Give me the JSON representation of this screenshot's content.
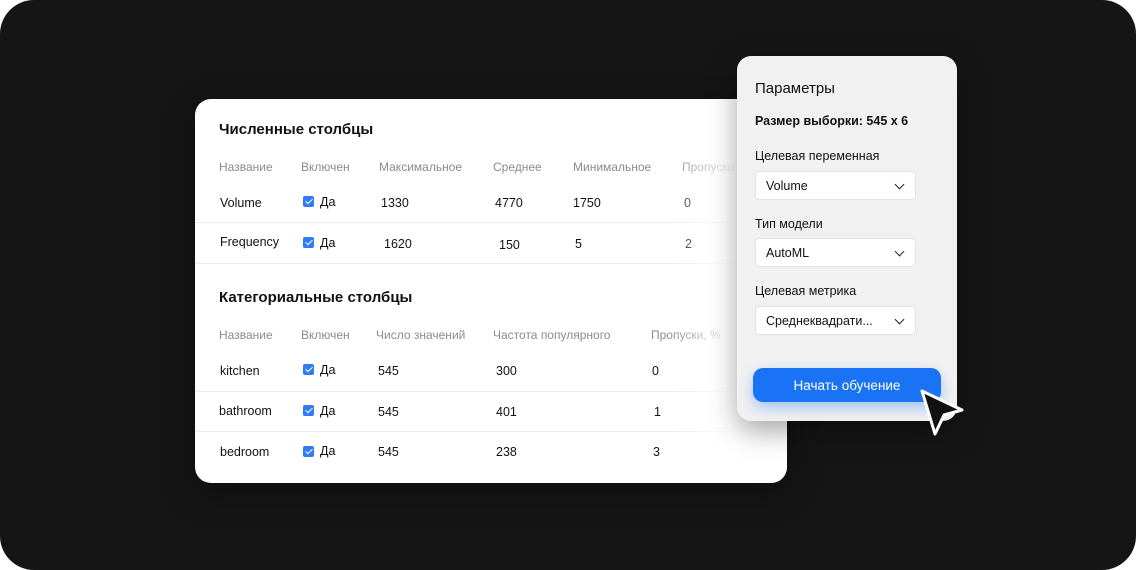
{
  "numeric": {
    "title": "Численные столбцы",
    "headers": [
      "Название",
      "Включен",
      "Максимальное",
      "Среднее",
      "Минимальное",
      "Пропуски"
    ],
    "rows": [
      {
        "name": "Volume",
        "enabled": "Да",
        "max": "1330",
        "mean": "4770",
        "min": "1750",
        "missing": "0"
      },
      {
        "name": "Frequency",
        "enabled": "Да",
        "max": "1620",
        "mean": "150",
        "min": "5",
        "missing": "2"
      }
    ]
  },
  "categorical": {
    "title": "Категориальные столбцы",
    "headers": [
      "Название",
      "Включен",
      "Число значений",
      "Частота популярного",
      "Пропуски, %"
    ],
    "rows": [
      {
        "name": "kitchen",
        "enabled": "Да",
        "count": "545",
        "freq": "300",
        "missing": "0"
      },
      {
        "name": "bathroom",
        "enabled": "Да",
        "count": "545",
        "freq": "401",
        "missing": "1"
      },
      {
        "name": "bedroom",
        "enabled": "Да",
        "count": "545",
        "freq": "238",
        "missing": "3"
      }
    ]
  },
  "params": {
    "title": "Параметры",
    "sample_size": "Размер выборки: 545 x 6",
    "target_label": "Целевая переменная",
    "target_value": "Volume",
    "model_label": "Тип модели",
    "model_value": "AutoML",
    "metric_label": "Целевая метрика",
    "metric_value": "Среднеквадрати...",
    "start_button": "Начать обучение"
  },
  "colors": {
    "background": "#151515",
    "accent": "#1a73f5",
    "checkbox": "#2f7cf6"
  },
  "icons": [
    "checkbox-checked-icon",
    "chevron-down-icon",
    "mouse-pointer-icon"
  ]
}
